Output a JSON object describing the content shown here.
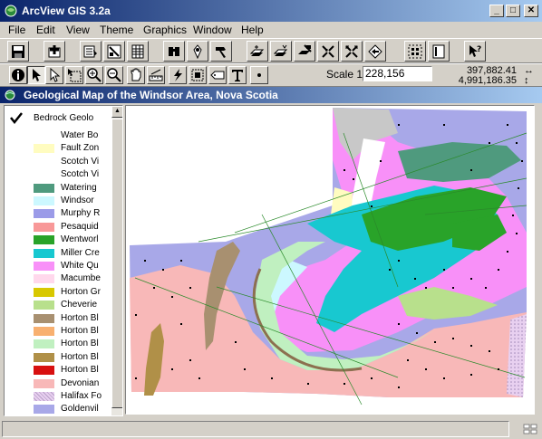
{
  "window": {
    "title": "ArcView GIS 3.2a",
    "minimize": "_",
    "maximize": "□",
    "close": "✕"
  },
  "menu": [
    "File",
    "Edit",
    "View",
    "Theme",
    "Graphics",
    "Window",
    "Help"
  ],
  "toolbar1": [
    "save-icon",
    "add-theme-icon",
    "theme-properties-icon",
    "open-table-icon",
    "find-icon",
    "locate-address-icon",
    "query-builder-icon",
    "zoom-full-extent-icon",
    "zoom-to-themes-icon",
    "zoom-to-selected-icon",
    "zoom-in-icon",
    "zoom-out-icon",
    "zoom-previous-icon",
    "select-features-icon",
    "clear-selection-icon",
    "help-icon"
  ],
  "toolbar2": [
    "identify-icon",
    "pointer-icon",
    "vertex-edit-icon",
    "select-feature-icon",
    "zoom-in-icon",
    "zoom-out-icon",
    "pan-icon",
    "measure-icon",
    "hotlink-icon",
    "area-of-interest-icon",
    "label-icon",
    "text-icon",
    "draw-point-icon"
  ],
  "scale": {
    "label": "Scale 1:",
    "value": "228,156"
  },
  "coordinates": {
    "x": "397,882.41",
    "y": "4,991,186.35",
    "x_arrow": "↔",
    "y_arrow": "↕"
  },
  "view": {
    "title": "Geological Map of the Windsor Area, Nova Scotia",
    "theme_name": "Bedrock Geolo",
    "legend": [
      {
        "label": "Water Bo",
        "color": "#ffffff"
      },
      {
        "label": "Fault Zon",
        "color": "#fffcc0"
      },
      {
        "label": "Scotch Vi",
        "color": "#ffffff"
      },
      {
        "label": "Scotch Vi",
        "color": "#ffffff"
      },
      {
        "label": "Watering",
        "color": "#4f9a7e"
      },
      {
        "label": "Windsor",
        "color": "#ccf8ff"
      },
      {
        "label": "Murphy R",
        "color": "#9b9be8"
      },
      {
        "label": "Pesaquid",
        "color": "#f89898"
      },
      {
        "label": "Wentworl",
        "color": "#29a329"
      },
      {
        "label": "Miller Cre",
        "color": "#18c8d0"
      },
      {
        "label": "White Qu",
        "color": "#f890f8"
      },
      {
        "label": "Macumbe",
        "color": "#ffd8ec"
      },
      {
        "label": "Horton Gr",
        "color": "#d8c800"
      },
      {
        "label": "Cheverie",
        "color": "#b8e08c"
      },
      {
        "label": "Horton Bl",
        "color": "#a89070"
      },
      {
        "label": "Horton Bl",
        "color": "#f8b070"
      },
      {
        "label": "Horton Bl",
        "color": "#c0f0c0"
      },
      {
        "label": "Horton Bl",
        "color": "#b09048"
      },
      {
        "label": "Horton Bl",
        "color": "#d81010"
      },
      {
        "label": "Devonian",
        "color": "#f8b8b8"
      },
      {
        "label": "Halifax Fo",
        "color": "#e8d0f0"
      },
      {
        "label": "Goldenvil",
        "color": "#a8a8e8"
      }
    ]
  },
  "map_colors": {
    "goldenville": "#a8a8e8",
    "devonian": "#f8b8b8",
    "white_quartz": "#f890f8",
    "miller_creek": "#18c8d0",
    "wentworth": "#29a329",
    "watering": "#4f9a7e",
    "cheverie": "#b8e08c",
    "horton_bluff": "#b09048",
    "fault_zone": "#fffcc0",
    "windsor": "#ccf8ff",
    "halifax": "#e8d0f0"
  }
}
